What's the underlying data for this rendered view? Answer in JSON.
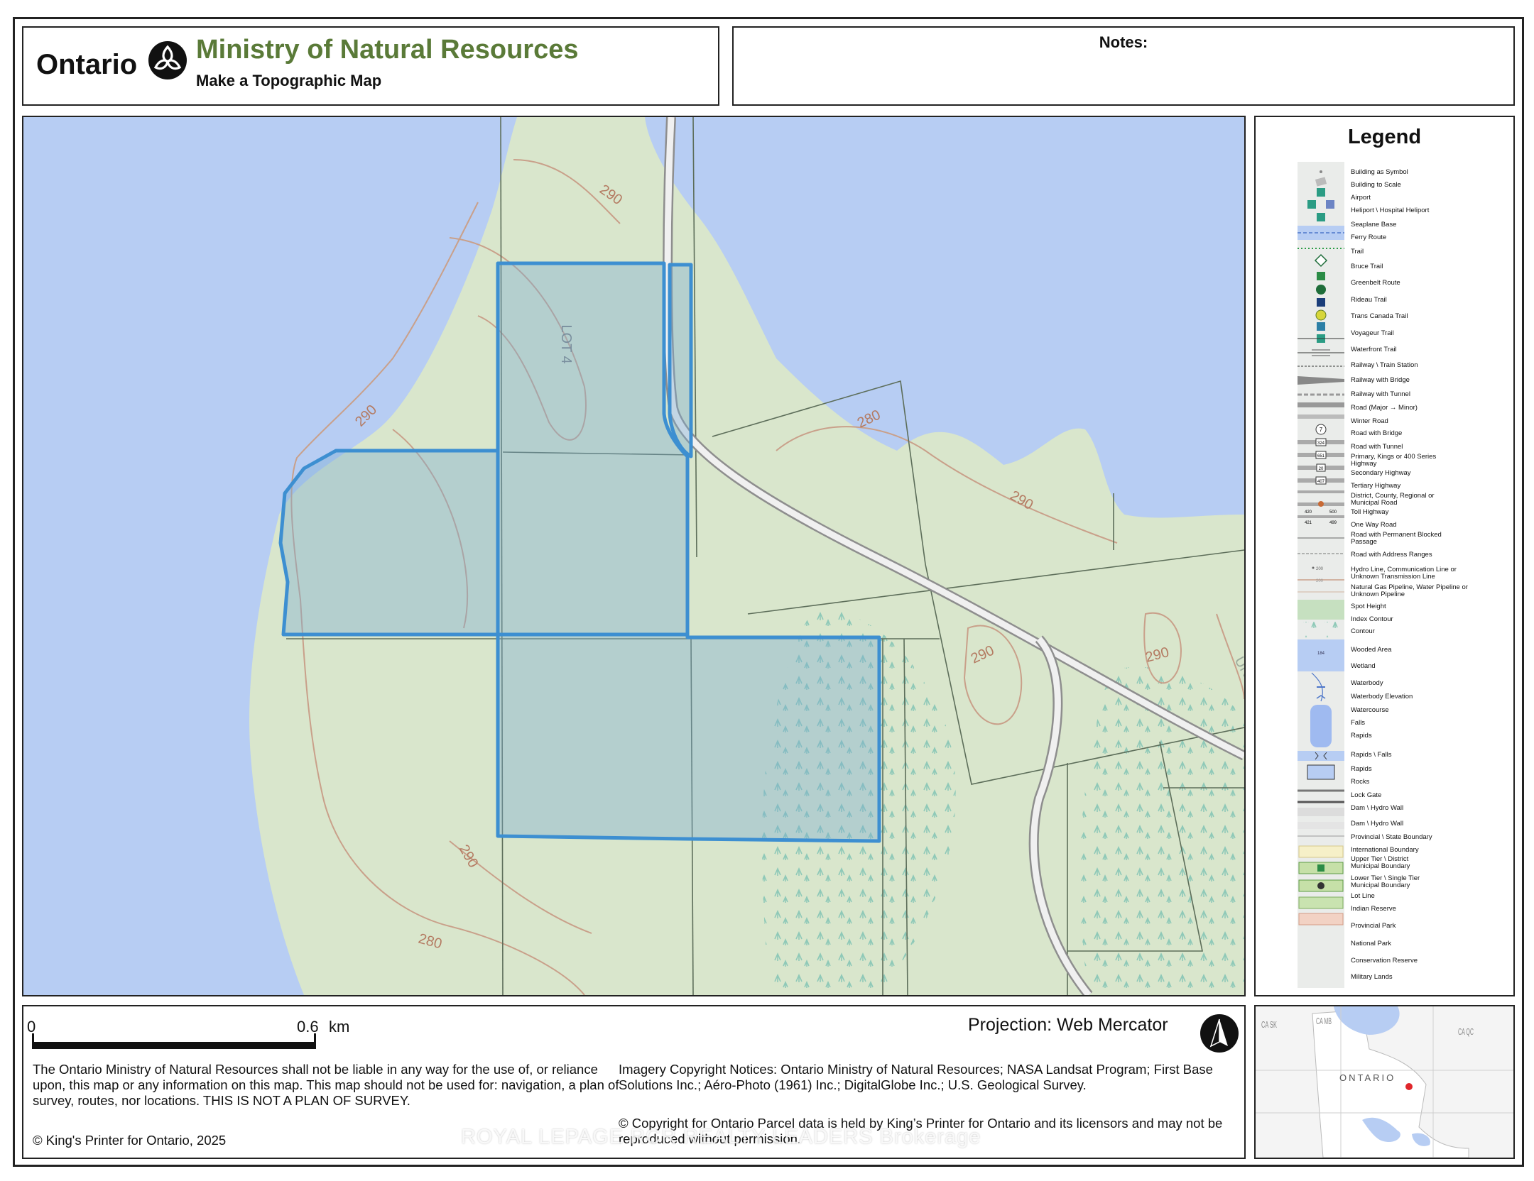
{
  "header": {
    "ontario_label": "Ontario",
    "ministry_title": "Ministry of Natural Resources",
    "subtitle": "Make a Topographic Map",
    "ministry_color": "#5a7a38"
  },
  "notes": {
    "label": "Notes:"
  },
  "map": {
    "colors": {
      "water": "#b7cdf3",
      "land": "#d9e6cc",
      "parcel_outline": "#3d8fd1",
      "contour": "#c9a08a",
      "road": "#8e8e8e"
    },
    "contour_labels": [
      "290",
      "290",
      "280",
      "290",
      "290",
      "290",
      "290",
      "280"
    ],
    "lot_label": "LOT 4",
    "partial_label": "UNO",
    "icons": [
      "parcel-outline",
      "wetland-marsh-symbol",
      "road",
      "lot-line"
    ]
  },
  "legend": {
    "title": "Legend",
    "items": [
      "Building as Symbol",
      "Building to Scale",
      "Airport",
      "Heliport \\ Hospital Heliport",
      "Seaplane Base",
      "Ferry Route",
      "Trail",
      "Bruce Trail",
      "Greenbelt Route",
      "Rideau Trail",
      "Trans Canada Trail",
      "Voyageur Trail",
      "Waterfront Trail",
      "Railway \\ Train Station",
      "Railway with Bridge",
      "Railway with Tunnel",
      "Road (Major → Minor)",
      "Winter Road",
      "Road with Bridge",
      "Road with Tunnel",
      "Primary, Kings or 400 Series Highway",
      "Secondary Highway",
      "Tertiary Highway",
      "District, County, Regional or Municipal Road",
      "Toll Highway",
      "One Way Road",
      "Road with Permanent Blocked Passage",
      "Road with Address Ranges",
      "Hydro Line, Communication Line or Unknown Transmission Line",
      "Natural Gas Pipeline, Water Pipeline or Unknown Pipeline",
      "Spot Height",
      "Index Contour",
      "Contour",
      "Wooded Area",
      "Wetland",
      "Waterbody",
      "Waterbody Elevation",
      "Watercourse",
      "Falls",
      "Rapids",
      "Rapids \\ Falls",
      "Rapids",
      "Rocks",
      "Lock Gate",
      "Dam \\ Hydro Wall",
      "Dam \\ Hydro Wall",
      "Provincial \\ State Boundary",
      "International Boundary",
      "Upper Tier \\ District Municipal Boundary",
      "Lower Tier \\ Single Tier Municipal Boundary",
      "Lot Line",
      "Indian Reserve",
      "Provincial Park",
      "National Park",
      "Conservation Reserve",
      "Military Lands"
    ],
    "highway_shields": [
      "7",
      "324",
      "651",
      "20",
      "407"
    ],
    "address_range_numbers": [
      "420",
      "500",
      "421",
      "499"
    ],
    "spot_height_value": "200",
    "index_contour_value": "200",
    "waterbody_elevation_value": "184"
  },
  "footer": {
    "scale_start": "0",
    "scale_end": "0.6",
    "scale_unit": "km",
    "projection": "Projection: Web Mercator",
    "disclaimer": "The Ontario Ministry of Natural Resources shall not be liable in any way for the use of, or reliance upon, this map or any information on this map.  This map should not be used for: navigation, a plan of survey, routes, nor locations. THIS IS NOT A PLAN OF SURVEY.",
    "copyright": "© King's Printer for Ontario,  2025",
    "imagery_notice": "Imagery Copyright Notices: Ontario Ministry of Natural Resources; NASA Landsat Program; First Base Solutions Inc.; Aéro-Photo (1961) Inc.; DigitalGlobe Inc.; U.S. Geological Survey.",
    "parcel_notice": "© Copyright for Ontario Parcel data is held by King’s Printer for Ontario and its licensors and may not be reproduced without permission.",
    "watermark": "ROYAL LEPAGE RCR REALTY  LEADERS  Brokerage"
  },
  "inset": {
    "labels": [
      "CA SK",
      "CA MB",
      "CA QC",
      "ONTARIO"
    ],
    "location_marker_color": "#e0262b"
  }
}
